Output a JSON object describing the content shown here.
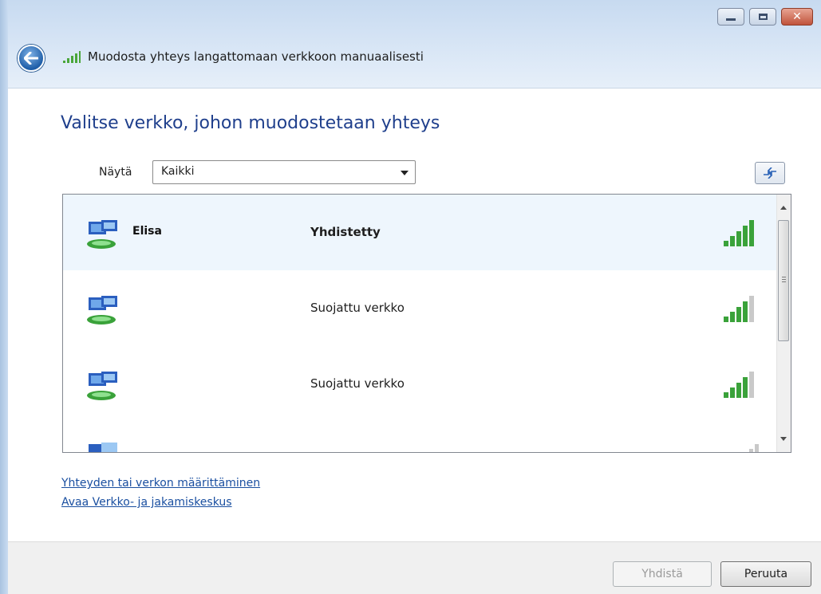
{
  "window": {
    "title": "Muodosta yhteys langattomaan verkkoon manuaalisesti"
  },
  "main": {
    "heading": "Valitse verkko, johon muodostetaan yhteys",
    "show_label": "Näytä",
    "show_value": "Kaikki"
  },
  "networks": [
    {
      "name": "Elisa",
      "status": "Yhdistetty",
      "signal": 5
    },
    {
      "name": "",
      "status": "Suojattu verkko",
      "signal": 4
    },
    {
      "name": "",
      "status": "Suojattu verkko",
      "signal": 4
    }
  ],
  "links": {
    "setup": "Yhteyden tai verkon määrittäminen",
    "network_center": "Avaa Verkko- ja jakamiskeskus"
  },
  "buttons": {
    "connect": "Yhdistä",
    "cancel": "Peruuta"
  },
  "icons": {
    "back": "back-arrow-icon",
    "title": "wireless-signal-icon",
    "refresh": "refresh-icon",
    "network": "wireless-network-icon",
    "signal": "signal-strength-icon"
  },
  "colors": {
    "heading": "#1f3f8c",
    "link": "#1a4fa0",
    "selected_row": "#eef6fd",
    "signal": "#3aa23a"
  }
}
